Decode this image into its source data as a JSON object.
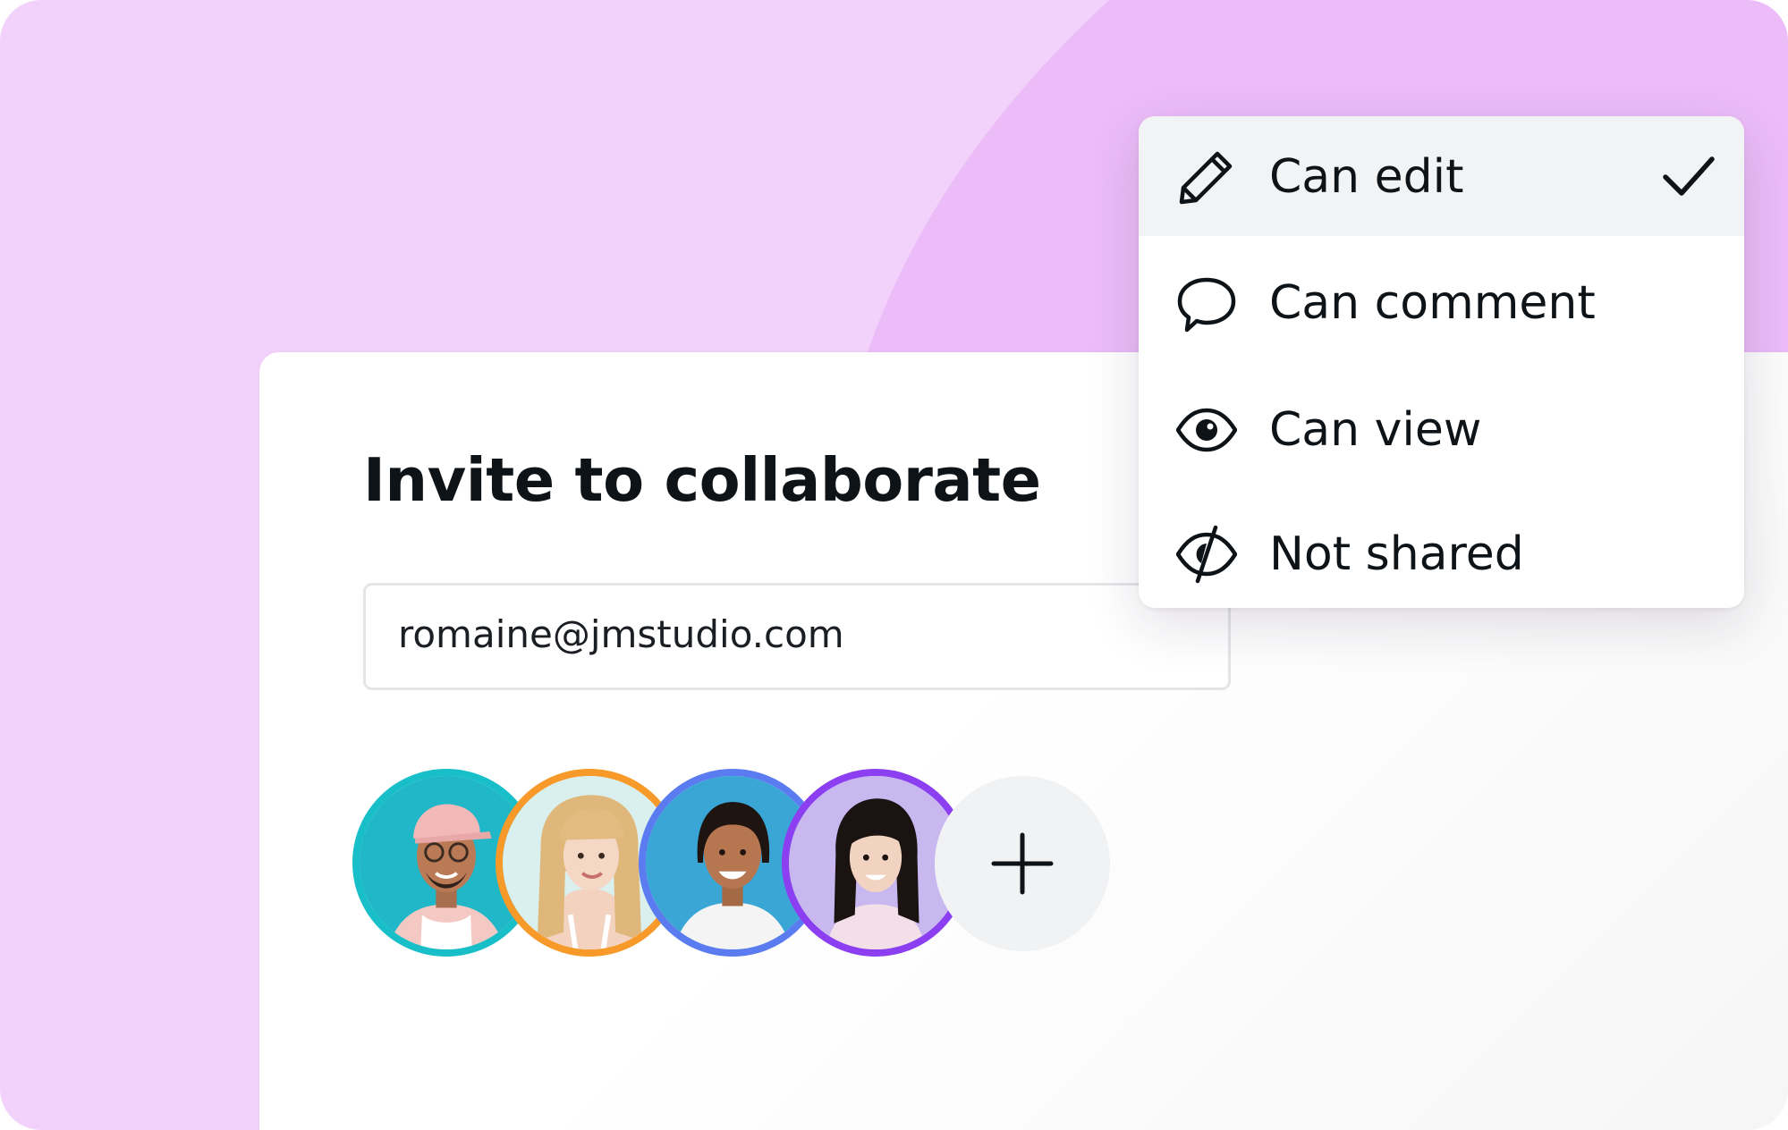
{
  "dialog": {
    "title": "Invite to collaborate",
    "email_value": "romaine@jmstudio.com"
  },
  "avatars": [
    {
      "name": "avatar-1",
      "ring_color": "#19bfc8",
      "bg_color": "#1fb3c6"
    },
    {
      "name": "avatar-2",
      "ring_color": "#f79a2a",
      "bg_color": "#d9f0ee"
    },
    {
      "name": "avatar-3",
      "ring_color": "#5b7cf0",
      "bg_color": "#3aa6d6"
    },
    {
      "name": "avatar-4",
      "ring_color": "#8b3ff0",
      "bg_color": "#c9b7ef"
    }
  ],
  "add_button": {
    "icon": "plus-icon"
  },
  "permission_menu": {
    "items": [
      {
        "label": "Can edit",
        "icon": "pencil-icon",
        "selected": true
      },
      {
        "label": "Can comment",
        "icon": "speech-bubble-icon",
        "selected": false
      },
      {
        "label": "Can view",
        "icon": "eye-icon",
        "selected": false
      },
      {
        "label": "Not shared",
        "icon": "eye-slash-icon",
        "selected": false
      }
    ],
    "selected_icon": "checkmark-icon"
  },
  "colors": {
    "background": "#f2d2fb",
    "background_curve": "#ebbcf8",
    "text": "#0e1318",
    "selected_row": "#f2f3f5"
  }
}
